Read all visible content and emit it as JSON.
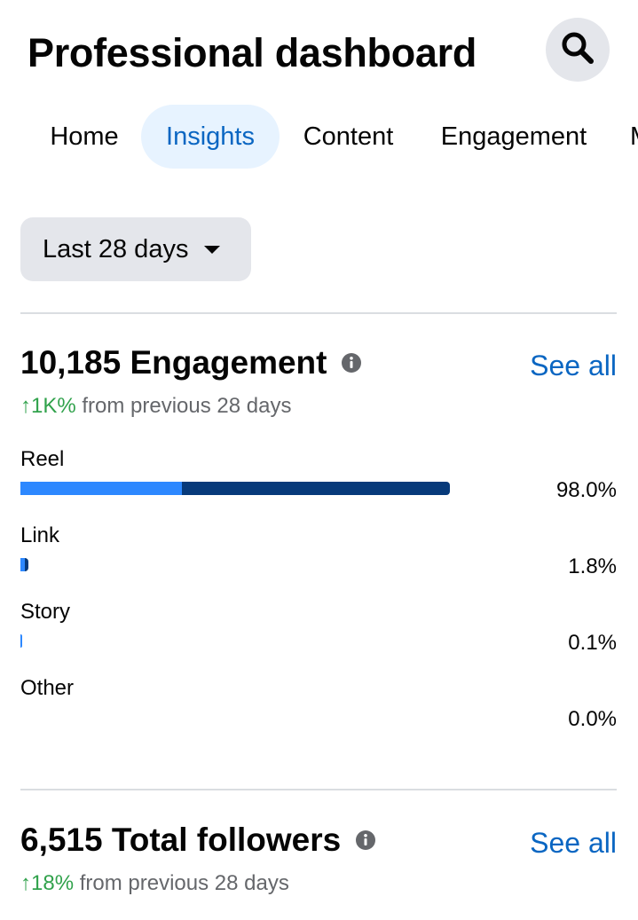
{
  "header": {
    "title": "Professional dashboard",
    "search_icon": "search-icon"
  },
  "tabs": [
    {
      "label": "Home",
      "active": false
    },
    {
      "label": "Insights",
      "active": true
    },
    {
      "label": "Content",
      "active": false
    },
    {
      "label": "Engagement",
      "active": false
    },
    {
      "label": "M",
      "active": false
    }
  ],
  "date_filter": {
    "label": "Last 28 days",
    "icon": "caret-down-icon"
  },
  "engagement": {
    "title": "10,185 Engagement",
    "see_all": "See all",
    "delta_value": "↑1K%",
    "delta_text": " from previous 28 days",
    "rows": [
      {
        "label": "Reel",
        "percent_text": "98.0%",
        "value": 98.0
      },
      {
        "label": "Link",
        "percent_text": "1.8%",
        "value": 1.8
      },
      {
        "label": "Story",
        "percent_text": "0.1%",
        "value": 0.1
      },
      {
        "label": "Other",
        "percent_text": "0.0%",
        "value": 0.0
      }
    ]
  },
  "followers": {
    "title": "6,515 Total followers",
    "see_all": "See all",
    "delta_value": "↑18%",
    "delta_text": " from previous 28 days"
  },
  "colors": {
    "accent": "#0a66c2",
    "positive": "#31a24c",
    "bar_light": "#2d88ff",
    "bar_dark": "#073a7a"
  }
}
